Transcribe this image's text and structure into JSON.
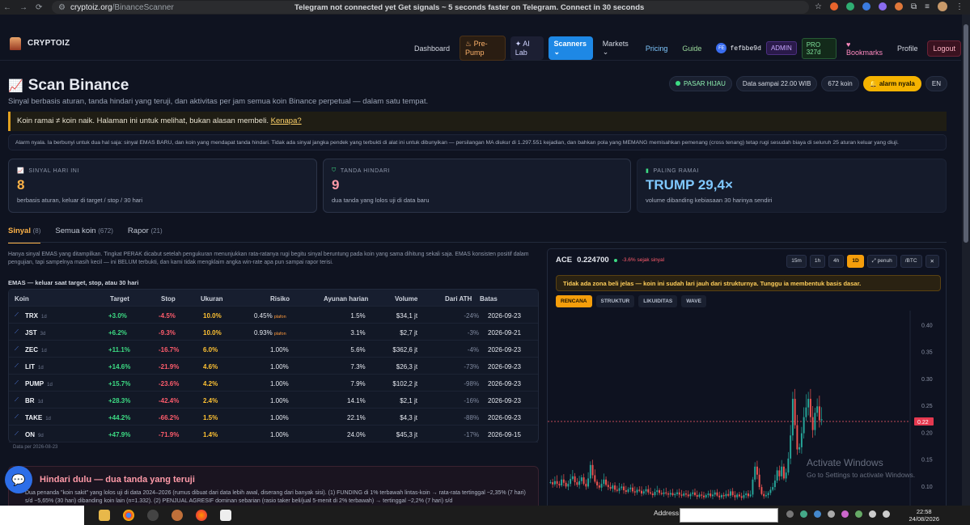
{
  "browser": {
    "url_host": "cryptoiz.org",
    "url_path": "/BinanceScanner",
    "marquee": "Telegram not connected yet Get signals ~ 5 seconds faster on Telegram. Connect in 30 seconds"
  },
  "nav": {
    "brand": "CRYPTOIZ",
    "items": [
      "Dashboard",
      "Pre-Pump",
      "AI Lab",
      "Scanners",
      "Markets",
      "Pricing",
      "Guide"
    ],
    "user_initials": "FE",
    "user_id": "fefbbe9d",
    "admin": "ADMIN",
    "pro": "PRO 327d",
    "bookmarks": "Bookmarks",
    "profile": "Profile",
    "logout": "Logout"
  },
  "header": {
    "title": "Scan Binance",
    "subtitle": "Sinyal berbasis aturan, tanda hindari yang teruji, dan aktivitas per jam semua koin Binance perpetual — dalam satu tempat.",
    "market": "PASAR HIJAU",
    "data_until": "Data sampai 22.00 WIB",
    "coins": "672 koin",
    "alarm": "alarm nyala",
    "lang": "EN"
  },
  "notice": {
    "text": "Koin ramai ≠ koin naik. Halaman ini untuk melihat, bukan alasan membeli.",
    "link": "Kenapa?"
  },
  "alarm_text": "Alarm nyala. Ia berbunyi untuk dua hal saja: sinyal EMAS BARU, dan koin yang mendapat tanda hindari. Tidak ada sinyal jangka pendek yang terbukti di alat ini untuk dibunyikan — persilangan MA diukur di 1.297.551 kejadian, dan bahkan pola yang MEMANG memisahkan pemenang (cross tenang) tetap rugi sesudah biaya di seluruh 25 aturan keluar yang diuji.",
  "cards": [
    {
      "label": "SINYAL HARI INI",
      "value": "8",
      "sub": "berbasis aturan, keluar di target / stop / 30 hari"
    },
    {
      "label": "TANDA HINDARI",
      "value": "9",
      "sub": "dua tanda yang lolos uji di data baru"
    },
    {
      "label": "PALING RAMAI",
      "value": "TRUMP 29,4×",
      "sub": "volume dibanding kebiasaan 30 harinya sendiri"
    }
  ],
  "tabs": [
    {
      "label": "Sinyal",
      "count": "(8)"
    },
    {
      "label": "Semua koin",
      "count": "(672)"
    },
    {
      "label": "Rapor",
      "count": "(21)"
    }
  ],
  "description": "Hanya sinyal EMAS yang ditampilkan. Tingkat PERAK dicabut setelah pengukuran menunjukkan rata-ratanya rugi begitu sinyal beruntung pada koin yang sama dihitung sekali saja. EMAS konsisten positif dalam pengujian, tapi sampelnya masih kecil — ini BELUM terbukti, dan kami tidak mengklaim angka win-rate apa pun sampai rapor terisi.",
  "table": {
    "title": "EMAS — keluar saat target, stop, atau 30 hari",
    "headers": [
      "Koin",
      "Target",
      "Stop",
      "Ukuran",
      "Risiko",
      "Ayunan harian",
      "Volume",
      "Dari ATH",
      "Batas"
    ],
    "rows": [
      {
        "sym": "TRX",
        "age": "1d",
        "target": "+3.0%",
        "stop": "-4.5%",
        "size": "10.0%",
        "risk": "0.45%",
        "plat": "plafon",
        "swing": "1.5%",
        "vol": "$34,1 jt",
        "ath": "-24%",
        "limit": "2026-09-23"
      },
      {
        "sym": "JST",
        "age": "3d",
        "target": "+6.2%",
        "stop": "-9.3%",
        "size": "10.0%",
        "risk": "0.93%",
        "plat": "plafon",
        "swing": "3.1%",
        "vol": "$2,7 jt",
        "ath": "-3%",
        "limit": "2026-09-21"
      },
      {
        "sym": "ZEC",
        "age": "1d",
        "target": "+11.1%",
        "stop": "-16.7%",
        "size": "6.0%",
        "risk": "1.00%",
        "plat": "",
        "swing": "5.6%",
        "vol": "$362,6 jt",
        "ath": "-4%",
        "limit": "2026-09-23"
      },
      {
        "sym": "LIT",
        "age": "1d",
        "target": "+14.6%",
        "stop": "-21.9%",
        "size": "4.6%",
        "risk": "1.00%",
        "plat": "",
        "swing": "7.3%",
        "vol": "$26,3 jt",
        "ath": "-73%",
        "limit": "2026-09-23"
      },
      {
        "sym": "PUMP",
        "age": "1d",
        "target": "+15.7%",
        "stop": "-23.6%",
        "size": "4.2%",
        "risk": "1.00%",
        "plat": "",
        "swing": "7.9%",
        "vol": "$102,2 jt",
        "ath": "-98%",
        "limit": "2026-09-23"
      },
      {
        "sym": "BR",
        "age": "1d",
        "target": "+28.3%",
        "stop": "-42.4%",
        "size": "2.4%",
        "risk": "1.00%",
        "plat": "",
        "swing": "14.1%",
        "vol": "$2,1 jt",
        "ath": "-16%",
        "limit": "2026-09-23"
      },
      {
        "sym": "TAKE",
        "age": "1d",
        "target": "+44.2%",
        "stop": "-66.2%",
        "size": "1.5%",
        "risk": "1.00%",
        "plat": "",
        "swing": "22.1%",
        "vol": "$4,3 jt",
        "ath": "-88%",
        "limit": "2026-09-23"
      },
      {
        "sym": "ON",
        "age": "9d",
        "target": "+47.9%",
        "stop": "-71.9%",
        "size": "1.4%",
        "risk": "1.00%",
        "plat": "",
        "swing": "24.0%",
        "vol": "$45,3 jt",
        "ath": "-17%",
        "limit": "2026-09-15"
      }
    ],
    "footer": "Data per 2026-08-23"
  },
  "hindari": {
    "title": "Hindari dulu — dua tanda yang teruji",
    "text": "Dua penanda \"koin sakit\" yang lolos uji di data 2024–2026 (rumus dibuat dari data lebih awal, diserang dari banyak sisi). (1) FUNDING di 1% terbawah lintas-koin → rata-rata tertinggal −2,35% (7 hari) s/d −5,65% (30 hari) dibanding koin lain (n=1.332). (2) PENJUAL AGRESIF dominan sebarian (rasio taker beli/jual 5-menit di 2% terbawah) → tertinggal −2,2% (7 hari) s/d"
  },
  "chart_panel": {
    "symbol": "ACE",
    "price": "0.224700",
    "change": "-3.6% sejak sinyal",
    "timeframes": [
      "15m",
      "1h",
      "4h",
      "1D",
      "penuh",
      "/BTC"
    ],
    "active_tf": "1D",
    "warning": "Tidak ada zona beli jelas — koin ini sudah lari jauh dari strukturnya. Tunggu ia membentuk basis dasar.",
    "tabs": [
      "RENCANA",
      "STRUKTUR",
      "LIKUIDITAS",
      "WAVE"
    ],
    "active_tab": "RENCANA",
    "watermark_title": "Activate Windows",
    "watermark_sub": "Go to Settings to activate Windows."
  },
  "chart_data": {
    "type": "candlestick",
    "title": "ACE",
    "ylim": [
      0.05,
      0.42
    ],
    "yticks": [
      "0.40",
      "0.35",
      "0.30",
      "0.25",
      "0.20",
      "0.15",
      "0.10"
    ],
    "current_price": 0.22,
    "current_label": "0.22",
    "close_series": [
      0.107,
      0.103,
      0.109,
      0.104,
      0.101,
      0.112,
      0.106,
      0.099,
      0.104,
      0.113,
      0.118,
      0.107,
      0.102,
      0.109,
      0.116,
      0.104,
      0.099,
      0.114,
      0.139,
      0.12,
      0.108,
      0.101,
      0.097,
      0.104,
      0.112,
      0.102,
      0.098,
      0.095,
      0.101,
      0.093,
      0.091,
      0.096,
      0.099,
      0.092,
      0.089,
      0.094,
      0.097,
      0.09,
      0.088,
      0.093,
      0.091,
      0.086,
      0.09,
      0.094,
      0.088,
      0.086,
      0.083,
      0.089,
      0.092,
      0.087,
      0.085,
      0.088,
      0.086,
      0.084,
      0.087,
      0.083,
      0.085,
      0.088,
      0.084,
      0.082,
      0.086,
      0.084,
      0.081,
      0.085,
      0.088,
      0.083,
      0.08,
      0.084,
      0.082,
      0.079,
      0.083,
      0.086,
      0.081,
      0.084,
      0.088,
      0.082,
      0.079,
      0.083,
      0.081,
      0.085,
      0.082,
      0.09,
      0.083,
      0.079,
      0.084,
      0.081,
      0.078,
      0.083,
      0.086,
      0.081,
      0.084,
      0.112,
      0.136,
      0.121,
      0.098,
      0.085,
      0.081,
      0.083,
      0.087,
      0.093,
      0.098,
      0.11,
      0.129,
      0.118,
      0.136,
      0.114,
      0.125,
      0.151,
      0.194,
      0.262,
      0.213,
      0.168,
      0.172,
      0.198,
      0.228,
      0.246,
      0.262,
      0.228,
      0.204,
      0.236,
      0.248,
      0.222,
      0.224
    ]
  },
  "taskbar": {
    "address": "Address",
    "time": "22:58",
    "date": "24/08/2026"
  }
}
